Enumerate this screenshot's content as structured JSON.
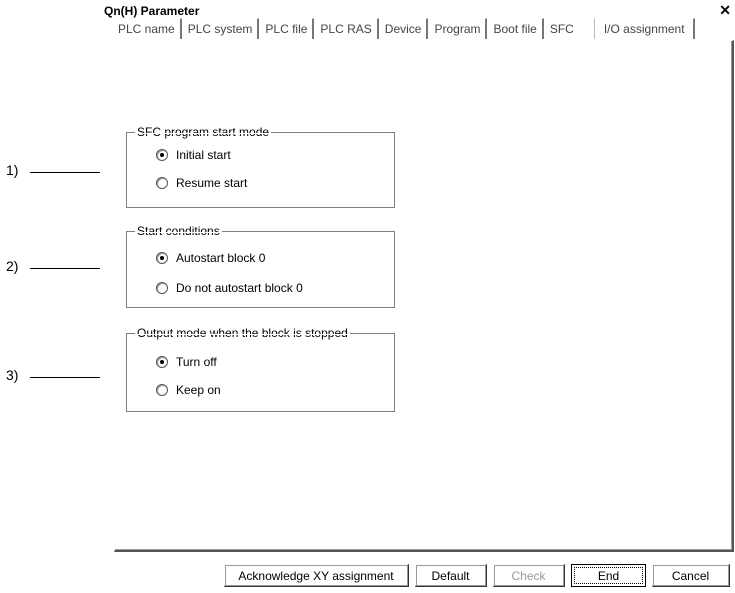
{
  "window": {
    "title": "Qn(H) Parameter",
    "close_glyph": "✕"
  },
  "tabs": [
    {
      "label": "PLC name"
    },
    {
      "label": "PLC system"
    },
    {
      "label": "PLC file"
    },
    {
      "label": "PLC RAS"
    },
    {
      "label": "Device"
    },
    {
      "label": "Program"
    },
    {
      "label": "Boot file"
    },
    {
      "label": "SFC",
      "active": true
    },
    {
      "label": "I/O assignment"
    }
  ],
  "groups": {
    "start_mode": {
      "label": "SFC program start mode",
      "options": [
        "Initial start",
        "Resume start"
      ],
      "selected": 0
    },
    "start_conditions": {
      "label": "Start conditions",
      "options": [
        "Autostart block 0",
        "Do not autostart block 0"
      ],
      "selected": 0
    },
    "output_mode": {
      "label": "Output mode when the block is stopped",
      "options": [
        "Turn off",
        "Keep on"
      ],
      "selected": 0
    }
  },
  "callouts": [
    "1)",
    "2)",
    "3)"
  ],
  "buttons": {
    "acknowledge": "Acknowledge XY assignment",
    "default": "Default",
    "check": "Check",
    "end": "End",
    "cancel": "Cancel"
  }
}
